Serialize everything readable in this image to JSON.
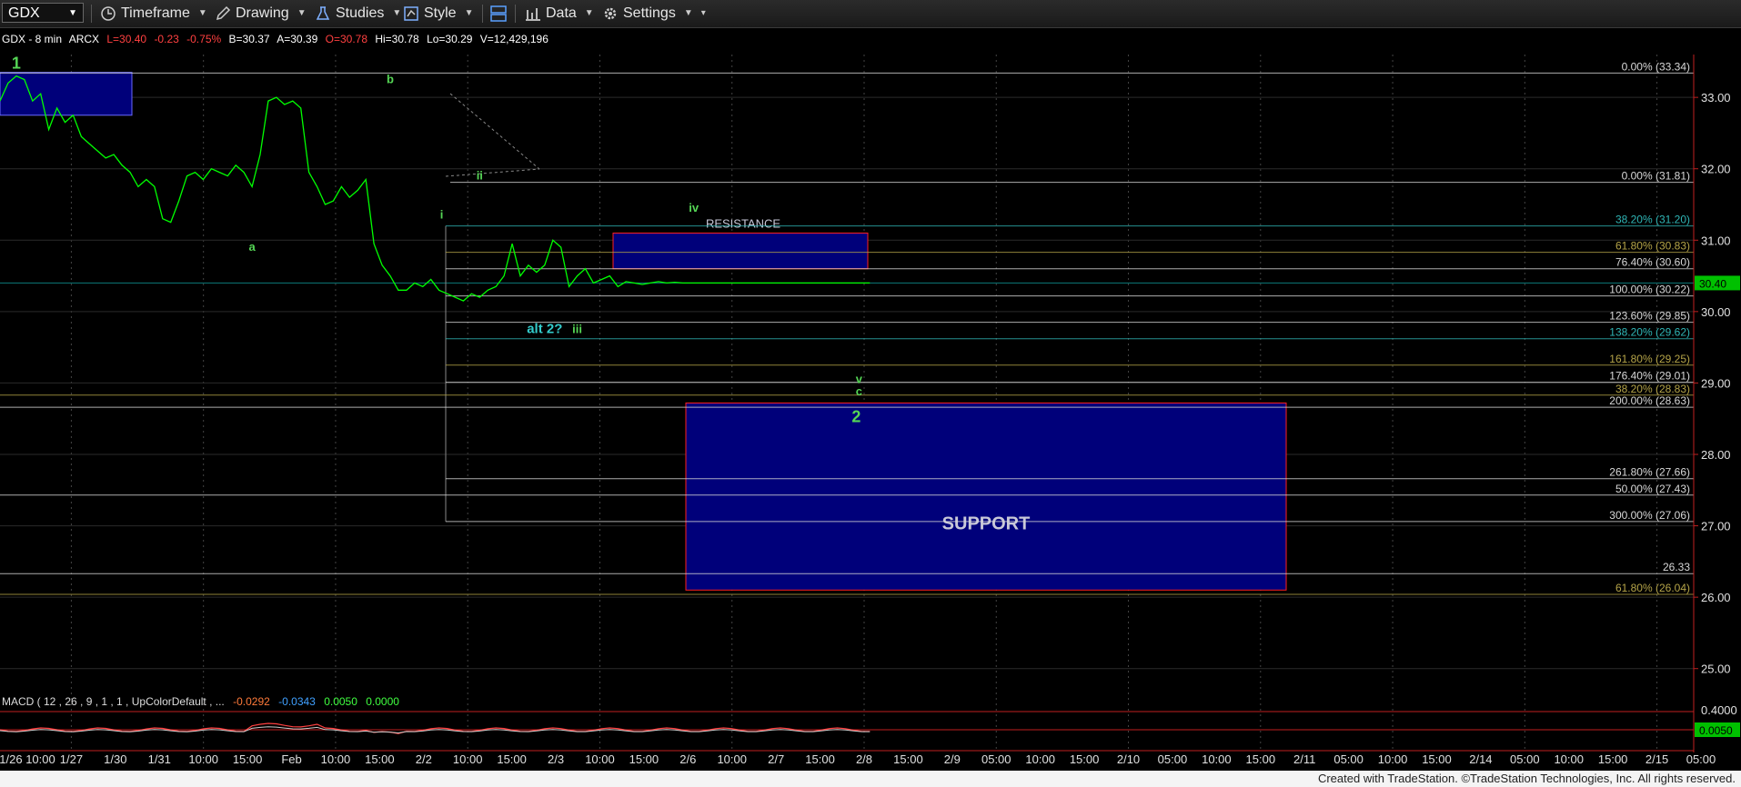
{
  "toolbar": {
    "symbol": "GDX",
    "timeframe_label": "Timeframe",
    "drawing_label": "Drawing",
    "studies_label": "Studies",
    "style_label": "Style",
    "data_label": "Data",
    "settings_label": "Settings"
  },
  "header": {
    "name": "GDX - 8 min",
    "exchange": "ARCX",
    "last": "L=30.40",
    "change": "-0.23",
    "change_pct": "-0.75%",
    "bid": "B=30.37",
    "ask": "A=30.39",
    "open": "O=30.78",
    "high": "Hi=30.78",
    "low": "Lo=30.29",
    "volume": "V=12,429,196"
  },
  "colors": {
    "price_line": "#00ff00",
    "box_fill": "#00007a",
    "box_border": "#ff2020",
    "fib_white": "#d8d8d8",
    "fib_cyan": "#2fb6b6",
    "fib_olive": "#b5a448",
    "label_green": "#55d655",
    "label_cyan": "#33cccc"
  },
  "chart_data": {
    "type": "line",
    "title": "GDX - 8 min",
    "ylim": [
      24.5,
      33.6
    ],
    "y_ticks": [
      "33.00",
      "32.00",
      "31.00",
      "30.00",
      "29.00",
      "28.00",
      "27.00",
      "26.00",
      "25.00"
    ],
    "last_price_label": "30.40",
    "x_ticks": [
      "1/26 10:00",
      "1/27",
      "1/30",
      "1/31",
      "10:00",
      "15:00",
      "Feb",
      "10:00",
      "15:00",
      "2/2",
      "10:00",
      "15:00",
      "2/3",
      "10:00",
      "15:00",
      "2/6",
      "10:00",
      "2/7",
      "15:00",
      "2/8",
      "15:00",
      "2/9",
      "05:00",
      "10:00",
      "15:00",
      "2/10",
      "05:00",
      "10:00",
      "15:00",
      "2/11",
      "05:00",
      "10:00",
      "15:00",
      "2/14",
      "05:00",
      "10:00",
      "15:00",
      "2/15",
      "05:00"
    ],
    "series": [
      {
        "x": [
          0,
          0.3,
          0.6,
          0.9,
          1.2,
          1.5,
          1.8,
          2.1,
          2.4,
          2.7,
          3.0,
          3.3,
          3.6,
          3.9,
          4.2,
          4.5,
          4.8,
          5.1,
          5.4,
          5.7,
          6.0,
          6.3,
          6.6,
          6.9,
          7.2,
          7.5,
          7.8,
          8.1,
          8.4,
          8.7,
          9.0,
          9.3,
          9.6,
          9.9,
          10.2,
          10.5,
          10.8,
          11.1,
          11.4,
          11.7,
          12.0,
          12.3,
          12.6,
          12.9,
          13.2,
          13.5,
          13.8,
          14.1,
          14.4,
          14.7,
          15.0,
          15.3,
          15.6,
          15.9,
          16.2,
          16.5,
          16.8,
          17.1,
          17.4,
          17.7,
          18.0,
          18.3,
          18.6,
          18.9,
          19.2,
          19.5,
          19.8,
          20.1,
          20.4,
          20.7,
          21.0,
          21.3,
          21.6,
          21.9,
          22.2,
          22.5,
          22.8,
          23.1,
          23.4,
          23.7,
          24.0,
          24.3,
          24.6,
          24.9,
          25.2,
          25.5,
          25.8,
          26.1,
          26.4,
          26.7,
          27.0,
          27.3,
          27.6,
          27.9,
          28.2,
          28.5,
          28.8,
          29.1,
          29.4,
          29.7,
          30.0,
          30.3,
          30.6,
          30.9,
          31.2,
          31.5,
          31.8,
          32.1
        ],
        "values": [
          32.95,
          33.2,
          33.3,
          33.25,
          32.95,
          33.05,
          32.55,
          32.85,
          32.65,
          32.75,
          32.45,
          32.35,
          32.25,
          32.15,
          32.2,
          32.05,
          31.95,
          31.75,
          31.85,
          31.75,
          31.3,
          31.25,
          31.55,
          31.9,
          31.95,
          31.85,
          32.0,
          31.95,
          31.9,
          32.05,
          31.95,
          31.75,
          32.2,
          32.95,
          33.0,
          32.9,
          32.95,
          32.85,
          31.95,
          31.75,
          31.5,
          31.55,
          31.75,
          31.6,
          31.7,
          31.85,
          30.95,
          30.65,
          30.5,
          30.3,
          30.3,
          30.4,
          30.35,
          30.45,
          30.3,
          30.25,
          30.2,
          30.15,
          30.25,
          30.2,
          30.3,
          30.35,
          30.5,
          30.95,
          30.5,
          30.65,
          30.55,
          30.65,
          31.0,
          30.9,
          30.35,
          30.5,
          30.6,
          30.4,
          30.45,
          30.5,
          30.35,
          30.42,
          30.4,
          30.38,
          30.4,
          30.42,
          30.4,
          30.41,
          30.4,
          30.4,
          30.4,
          30.4,
          30.4,
          30.4,
          30.4,
          30.4,
          30.4,
          30.4,
          30.4,
          30.4,
          30.4,
          30.4,
          30.4,
          30.4,
          30.4,
          30.4,
          30.4,
          30.4,
          30.4,
          30.4,
          30.4,
          30.4
        ]
      }
    ],
    "fib_levels": [
      {
        "label": "0.00% (33.34)",
        "value": 33.34,
        "color": "white"
      },
      {
        "label": "0.00% (31.81)",
        "value": 31.81,
        "color": "white"
      },
      {
        "label": "38.20% (31.20)",
        "value": 31.2,
        "color": "cyan"
      },
      {
        "label": "61.80% (30.83)",
        "value": 30.83,
        "color": "olive"
      },
      {
        "label": "76.40% (30.60)",
        "value": 30.6,
        "color": "white"
      },
      {
        "label": "100.00% (30.22)",
        "value": 30.22,
        "color": "white"
      },
      {
        "label": "123.60% (29.85)",
        "value": 29.85,
        "color": "white"
      },
      {
        "label": "138.20% (29.62)",
        "value": 29.62,
        "color": "cyan"
      },
      {
        "label": "161.80% (29.25)",
        "value": 29.25,
        "color": "olive"
      },
      {
        "label": "176.40% (29.01)",
        "value": 29.01,
        "color": "white"
      },
      {
        "label": "38.20% (28.83)",
        "value": 28.83,
        "color": "olive"
      },
      {
        "label": "200.00% (28.63)",
        "value": 28.66,
        "color": "white"
      },
      {
        "label": "261.80% (27.66)",
        "value": 27.66,
        "color": "white"
      },
      {
        "label": "50.00% (27.43)",
        "value": 27.43,
        "color": "white"
      },
      {
        "label": "300.00% (27.06)",
        "value": 27.06,
        "color": "white"
      },
      {
        "label": "26.33",
        "value": 26.33,
        "color": "white"
      },
      {
        "label": "61.80% (26.04)",
        "value": 26.04,
        "color": "olive"
      }
    ],
    "zones": [
      {
        "label": "RESISTANCE",
        "from": 30.6,
        "to": 31.1
      },
      {
        "label": "SUPPORT",
        "from": 26.1,
        "to": 28.72
      },
      {
        "label": "",
        "from": 32.75,
        "to": 33.35
      }
    ],
    "wave_labels": [
      {
        "text": "1",
        "x": 0.6,
        "y": 33.4,
        "color": "green",
        "size": "big"
      },
      {
        "text": "a",
        "x": 9.3,
        "y": 30.85,
        "color": "green",
        "size": "small"
      },
      {
        "text": "b",
        "x": 14.4,
        "y": 33.2,
        "color": "green",
        "size": "small"
      },
      {
        "text": "i",
        "x": 16.3,
        "y": 31.3,
        "color": "green",
        "size": "small"
      },
      {
        "text": "ii",
        "x": 17.7,
        "y": 31.85,
        "color": "green",
        "size": "small"
      },
      {
        "text": "iii",
        "x": 21.3,
        "y": 29.7,
        "color": "green",
        "size": "small"
      },
      {
        "text": "alt 2?",
        "x": 20.1,
        "y": 29.7,
        "color": "cyan",
        "size": "med"
      },
      {
        "text": "iv",
        "x": 25.6,
        "y": 31.4,
        "color": "green",
        "size": "small"
      },
      {
        "text": "v",
        "x": 31.7,
        "y": 29.0,
        "color": "green",
        "size": "small"
      },
      {
        "text": "c",
        "x": 31.7,
        "y": 28.83,
        "color": "green",
        "size": "small"
      },
      {
        "text": "2",
        "x": 31.6,
        "y": 28.45,
        "color": "green",
        "size": "big"
      }
    ],
    "macd": {
      "label": "MACD ( 12 , 26 , 9 , 1 , 1 , UpColorDefault , ...",
      "macd_value": "-0.0292",
      "signal_value": "-0.0343",
      "diff_value": "0.0050",
      "zero_value": "0.0000",
      "y_ticks": [
        "0.4000"
      ],
      "last_label": "0.0050"
    }
  },
  "footer": {
    "credit": "Created with TradeStation. ©TradeStation Technologies, Inc. All rights reserved."
  }
}
